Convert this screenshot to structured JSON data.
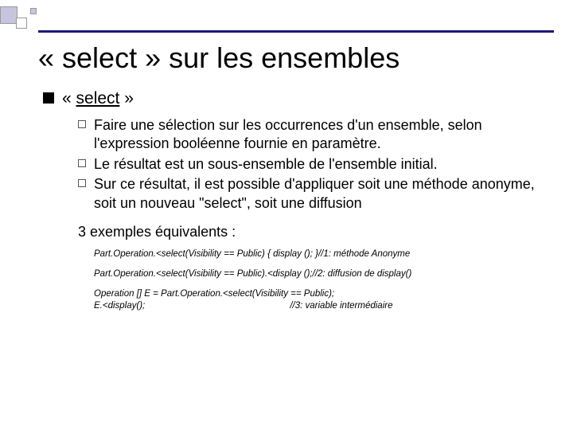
{
  "title": "« select » sur les ensembles",
  "level1": {
    "prefix": "« ",
    "keyword": "select",
    "suffix": " »"
  },
  "bullets": [
    "Faire une sélection sur les occurrences d'un ensemble, selon l'expression booléenne fournie en paramètre.",
    "Le résultat est un sous-ensemble de l'ensemble initial.",
    "Sur ce résultat, il est possible d'appliquer soit une méthode anonyme, soit un nouveau \"select\", soit une diffusion"
  ],
  "examples_intro": "3 exemples équivalents :",
  "code": [
    "Part.Operation.<select(Visibility == Public) { display (); }//1: méthode Anonyme",
    "Part.Operation.<select(Visibility == Public).<display ();//2: diffusion de display()",
    "Operation [] E = Part.Operation.<select(Visibility == Public);\nE.<display();                                                         //3: variable intermédiaire"
  ]
}
